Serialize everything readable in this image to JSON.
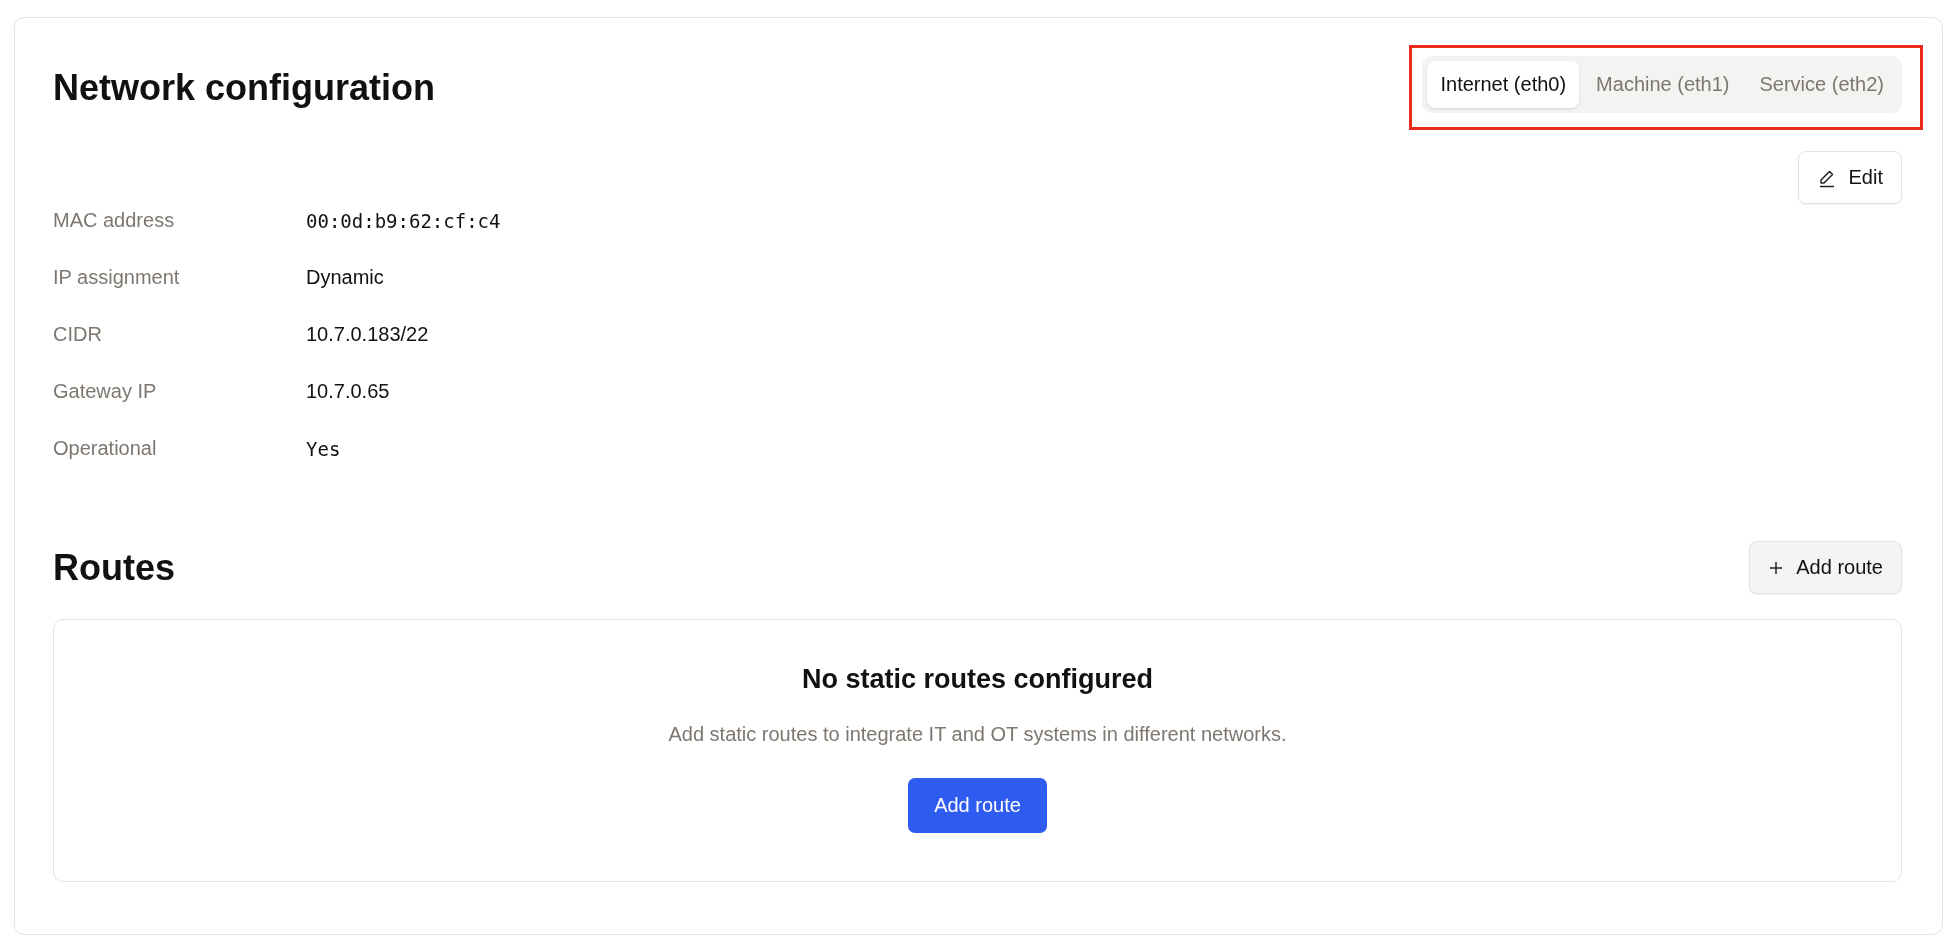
{
  "title": "Network configuration",
  "tabs": [
    {
      "label": "Internet (eth0)",
      "selected": true
    },
    {
      "label": "Machine (eth1)",
      "selected": false
    },
    {
      "label": "Service (eth2)",
      "selected": false
    }
  ],
  "highlight": {
    "on": true
  },
  "edit_button": "Edit",
  "fields": [
    {
      "label": "MAC address",
      "value": "00:0d:b9:62:cf:c4",
      "kind": "mono"
    },
    {
      "label": "IP assignment",
      "value": "Dynamic",
      "kind": "text"
    },
    {
      "label": "CIDR",
      "value": "10.7.0.183/22",
      "kind": "text"
    },
    {
      "label": "Gateway IP",
      "value": "10.7.0.65",
      "kind": "text"
    },
    {
      "label": "Operational",
      "value": "Yes",
      "kind": "mono"
    }
  ],
  "routes": {
    "title": "Routes",
    "add_button": "Add route",
    "empty": {
      "title": "No static routes configured",
      "description": "Add static routes to integrate IT and OT systems in different networks.",
      "button": "Add route"
    }
  }
}
